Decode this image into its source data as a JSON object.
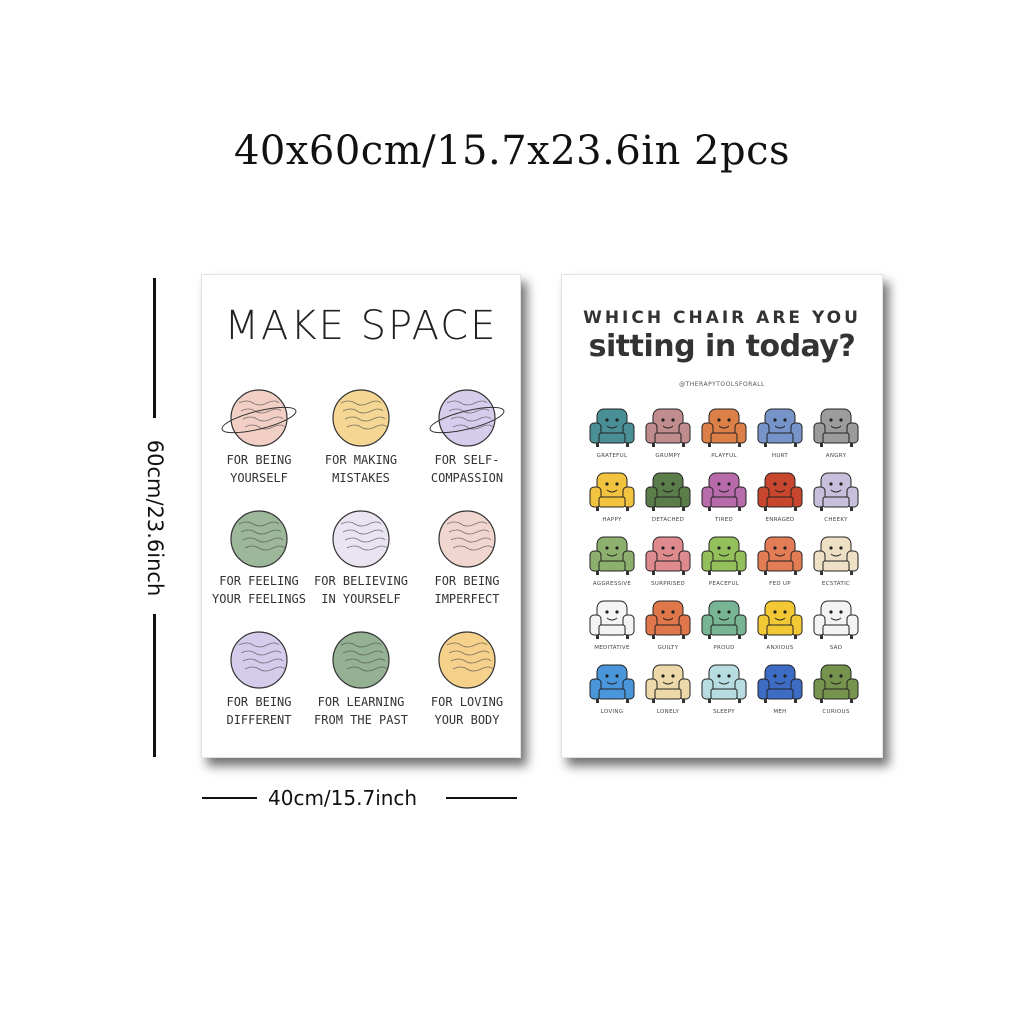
{
  "header": {
    "title": "40x60cm/15.7x23.6in 2pcs"
  },
  "dimensions": {
    "height_label": "60cm/23.6inch",
    "width_label": "40cm/15.7inch"
  },
  "poster_left": {
    "title": "MAKE SPACE",
    "planets": [
      {
        "label_line1": "FOR BEING",
        "label_line2": "YOURSELF",
        "color": "#f2cfc4",
        "ring": true
      },
      {
        "label_line1": "FOR MAKING",
        "label_line2": "MISTAKES",
        "color": "#f5d693",
        "ring": false
      },
      {
        "label_line1": "FOR SELF-",
        "label_line2": "COMPASSION",
        "color": "#d6cdec",
        "ring": true
      },
      {
        "label_line1": "FOR FEELING",
        "label_line2": "YOUR FEELINGS",
        "color": "#9cb79a",
        "ring": false
      },
      {
        "label_line1": "FOR BELIEVING",
        "label_line2": "IN YOURSELF",
        "color": "#e9e3f2",
        "ring": false
      },
      {
        "label_line1": "FOR BEING",
        "label_line2": "IMPERFECT",
        "color": "#f0d6cf",
        "ring": false
      },
      {
        "label_line1": "FOR BEING",
        "label_line2": "DIFFERENT",
        "color": "#d5cbeb",
        "ring": false
      },
      {
        "label_line1": "FOR LEARNING",
        "label_line2": "FROM THE PAST",
        "color": "#94b193",
        "ring": false
      },
      {
        "label_line1": "FOR LOVING",
        "label_line2": "YOUR BODY",
        "color": "#f5d18c",
        "ring": false
      }
    ]
  },
  "poster_right": {
    "title_line1": "WHICH CHAIR ARE YOU",
    "title_line2": "sitting in today?",
    "handle": "@THERAPYTOOLSFORALL",
    "chairs": [
      {
        "label": "GRATEFUL",
        "color": "#4a8f96"
      },
      {
        "label": "GRUMPY",
        "color": "#c08c8e"
      },
      {
        "label": "PLAYFUL",
        "color": "#dd8048"
      },
      {
        "label": "HURT",
        "color": "#7694c9"
      },
      {
        "label": "ANGRY",
        "color": "#9c9c9c"
      },
      {
        "label": "HAPPY",
        "color": "#f2c33f"
      },
      {
        "label": "DETACHED",
        "color": "#5b7d4a"
      },
      {
        "label": "TIRED",
        "color": "#b86bab"
      },
      {
        "label": "ENRAGED",
        "color": "#c8462e"
      },
      {
        "label": "CHEEKY",
        "color": "#c8bfdc"
      },
      {
        "label": "AGGRESSIVE",
        "color": "#8eb06e"
      },
      {
        "label": "SURPRISED",
        "color": "#df8a8f"
      },
      {
        "label": "PEACEFUL",
        "color": "#93c05a"
      },
      {
        "label": "FED UP",
        "color": "#e27d55"
      },
      {
        "label": "ECSTATIC",
        "color": "#ede0c5"
      },
      {
        "label": "MEDITATIVE",
        "color": "#f4f4f4"
      },
      {
        "label": "GUILTY",
        "color": "#e0774a"
      },
      {
        "label": "PROUD",
        "color": "#78b595"
      },
      {
        "label": "ANXIOUS",
        "color": "#f2c935"
      },
      {
        "label": "SAD",
        "color": "#f3f3f3"
      },
      {
        "label": "LOVING",
        "color": "#4a96db"
      },
      {
        "label": "LONELY",
        "color": "#ecd8a8"
      },
      {
        "label": "SLEEPY",
        "color": "#b8dde0"
      },
      {
        "label": "MEH",
        "color": "#3c6cc4"
      },
      {
        "label": "CURIOUS",
        "color": "#76944e"
      }
    ]
  }
}
